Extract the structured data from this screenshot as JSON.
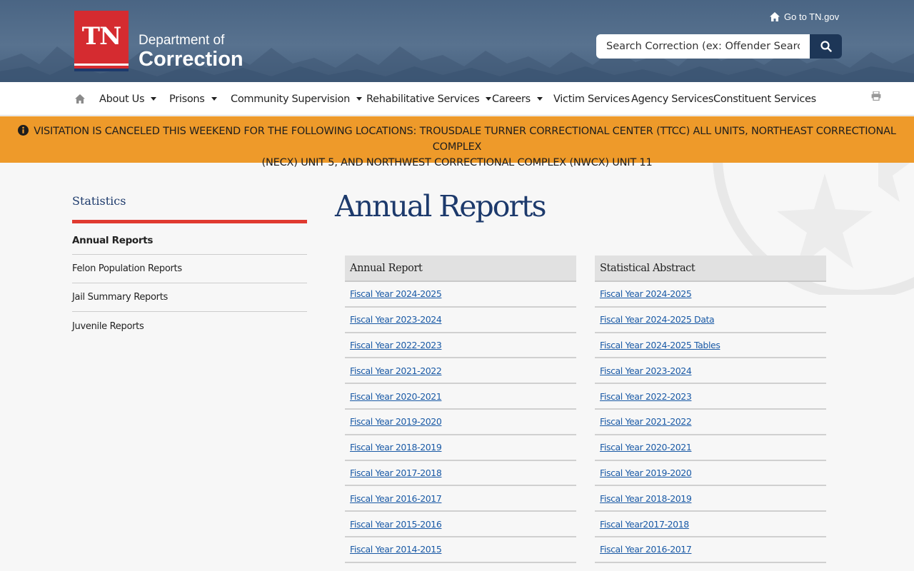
{
  "header": {
    "logo_mark": "TN",
    "logo_line1": "Department of",
    "logo_line2": "Correction",
    "go_tn": "Go to TN.gov",
    "search_placeholder": "Search Correction (ex: Offender Search)"
  },
  "nav": {
    "items": [
      {
        "label": "About Us",
        "has_dropdown": true
      },
      {
        "label": "Prisons",
        "has_dropdown": true
      },
      {
        "label": "Community Supervision",
        "has_dropdown": true
      },
      {
        "label": "Rehabilitative Services",
        "has_dropdown": true
      },
      {
        "label": "Careers",
        "has_dropdown": true
      },
      {
        "label": "Victim Services",
        "has_dropdown": false
      },
      {
        "label": "Agency Services",
        "has_dropdown": false
      },
      {
        "label": "Constituent Services",
        "has_dropdown": false
      }
    ]
  },
  "alert": {
    "line1": "VISITATION IS CANCELED THIS WEEKEND FOR THE FOLLOWING LOCATIONS: TROUSDALE TURNER CORRECTIONAL CENTER (TTCC) ALL UNITS, NORTHEAST CORRECTIONAL COMPLEX",
    "line2": "(NECX) UNIT 5, AND NORTHWEST CORRECTIONAL COMPLEX (NWCX) UNIT 11"
  },
  "sidebar": {
    "title": "Statistics",
    "items": [
      {
        "label": "Annual Reports",
        "active": true
      },
      {
        "label": "Felon Population Reports",
        "active": false
      },
      {
        "label": "Jail Summary Reports",
        "active": false
      },
      {
        "label": "Juvenile Reports",
        "active": false
      }
    ]
  },
  "main": {
    "title": "Annual Reports",
    "annual_report": {
      "heading": "Annual Report",
      "links": [
        "Fiscal Year 2024-2025",
        "Fiscal Year 2023-2024",
        "Fiscal Year 2022-2023",
        "Fiscal Year 2021-2022",
        "Fiscal Year 2020-2021",
        "Fiscal Year 2019-2020",
        "Fiscal Year 2018-2019",
        "Fiscal Year 2017-2018",
        "Fiscal Year 2016-2017",
        "Fiscal Year 2015-2016",
        "Fiscal Year 2014-2015"
      ]
    },
    "statistical_abstract": {
      "heading": "Statistical Abstract",
      "links": [
        "Fiscal Year 2024-2025",
        "Fiscal Year 2024-2025 Data",
        "Fiscal Year 2024-2025 Tables",
        "Fiscal Year 2023-2024",
        "Fiscal Year 2022-2023",
        "Fiscal Year 2021-2022",
        "Fiscal Year 2020-2021",
        "Fiscal Year 2019-2020",
        "Fiscal Year 2018-2019",
        "Fiscal Year2017-2018",
        "Fiscal Year 2016-2017"
      ]
    }
  },
  "colors": {
    "header_bg": "#4f6a89",
    "navy": "#1d3a6c",
    "logo_red": "#d52b30",
    "alert_bg": "#ee9a2a",
    "accent_red": "#e03a30",
    "link": "#1a5aa6"
  },
  "icons": [
    "home-icon",
    "search-icon",
    "info-icon",
    "print-icon",
    "caret-down-icon"
  ]
}
